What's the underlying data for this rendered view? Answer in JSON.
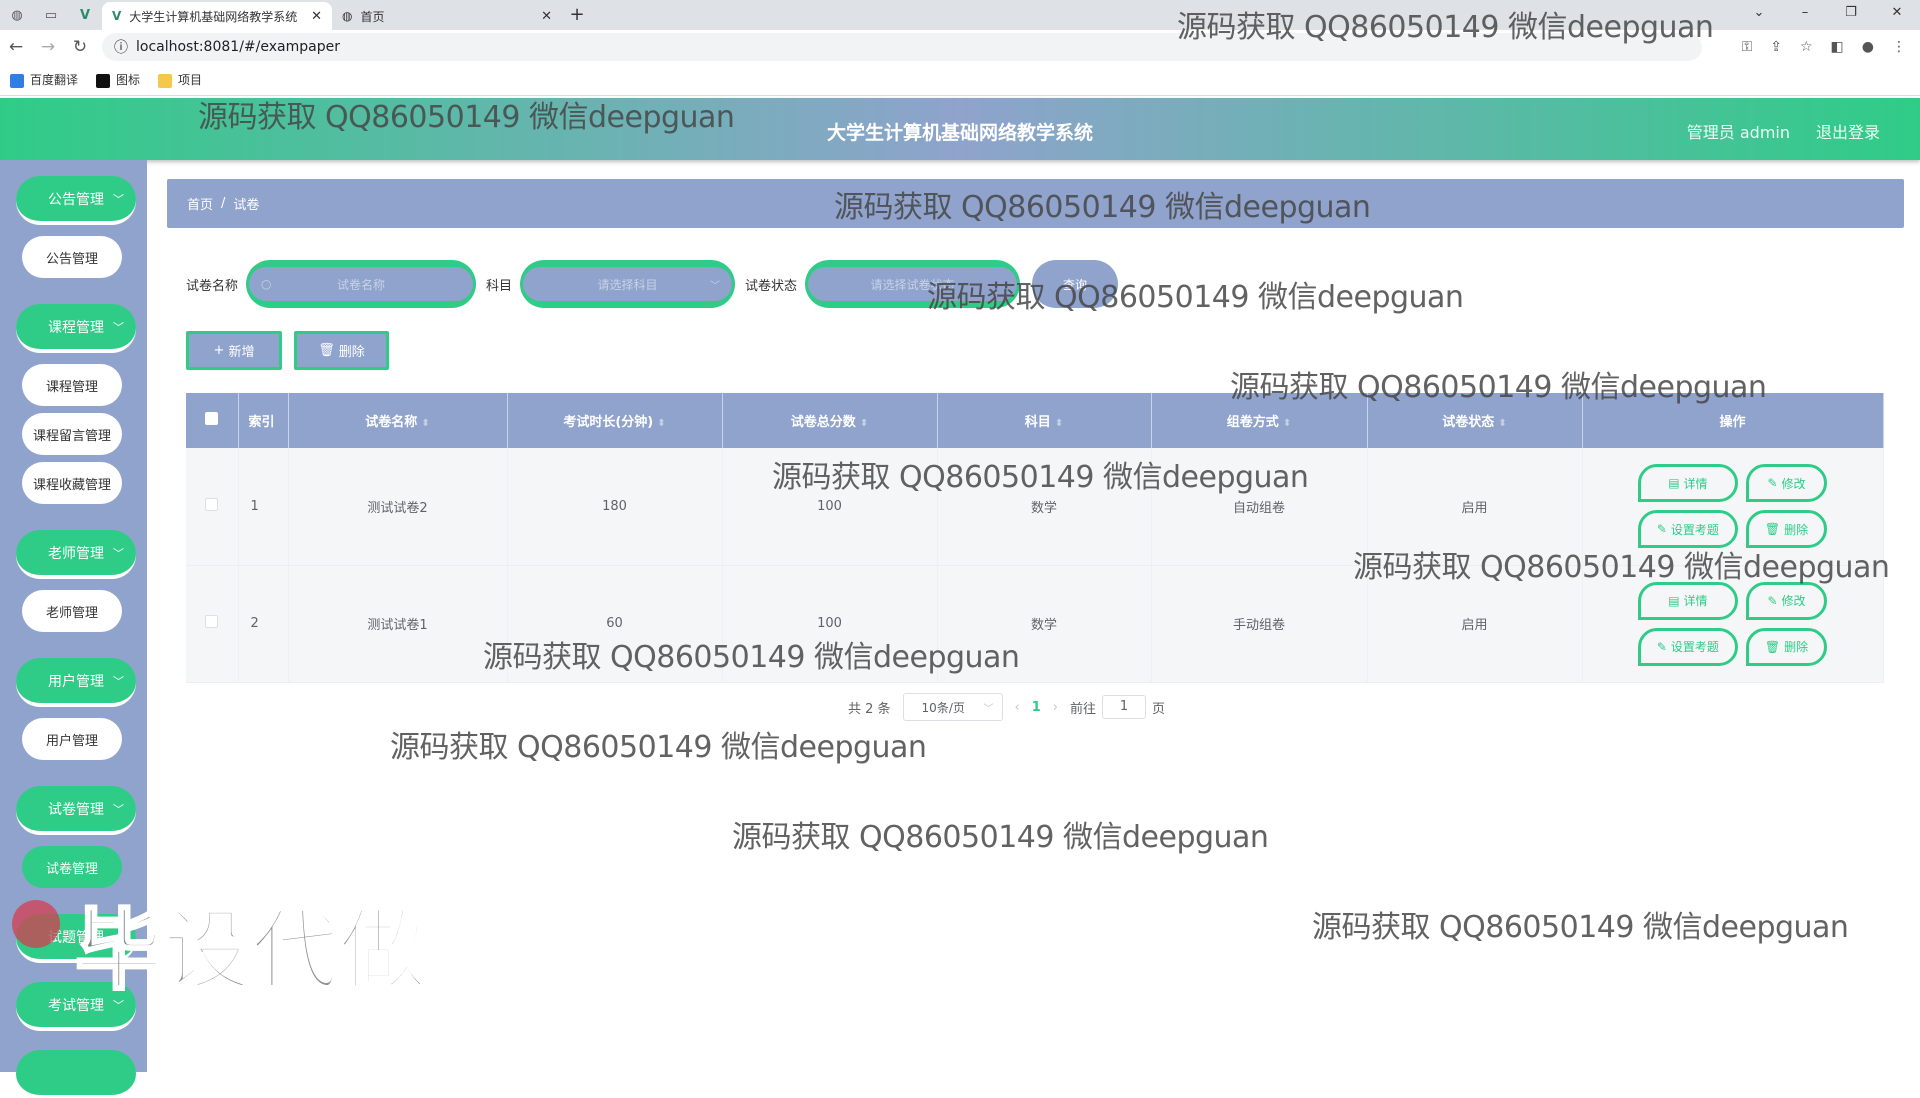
{
  "browser": {
    "tabs": [
      {
        "title": "大学生计算机基础网络教学系统",
        "active": true
      },
      {
        "title": "首页",
        "active": false
      }
    ],
    "url": "localhost:8081/#/exampaper",
    "bookmarks": [
      "百度翻译",
      "图标",
      "项目"
    ]
  },
  "header": {
    "title": "大学生计算机基础网络教学系统",
    "user": "管理员 admin",
    "logout": "退出登录"
  },
  "sidebar": {
    "menus": [
      {
        "label": "公告管理",
        "subs": [
          "公告管理"
        ]
      },
      {
        "label": "课程管理",
        "subs": [
          "课程管理",
          "课程留言管理",
          "课程收藏管理"
        ]
      },
      {
        "label": "老师管理",
        "subs": [
          "老师管理"
        ]
      },
      {
        "label": "用户管理",
        "subs": [
          "用户管理"
        ]
      },
      {
        "label": "试卷管理",
        "subs": [
          "试卷管理"
        ]
      },
      {
        "label": "试题管理",
        "subs": []
      },
      {
        "label": "考试管理",
        "subs": []
      }
    ],
    "active_sub": "试卷管理"
  },
  "breadcrumb": [
    "首页",
    "试卷"
  ],
  "search": {
    "name_label": "试卷名称",
    "name_placeholder": "试卷名称",
    "subject_label": "科目",
    "subject_placeholder": "请选择科目",
    "status_label": "试卷状态",
    "status_placeholder": "请选择试卷状态",
    "query": "查询"
  },
  "actions": {
    "add": "新增",
    "delete": "删除"
  },
  "table": {
    "columns": [
      "索引",
      "试卷名称",
      "考试时长(分钟)",
      "试卷总分数",
      "科目",
      "组卷方式",
      "试卷状态",
      "操作"
    ],
    "rows": [
      {
        "index": "1",
        "name": "测试试卷2",
        "duration": "180",
        "total": "100",
        "subject": "数学",
        "mode": "自动组卷",
        "status": "启用"
      },
      {
        "index": "2",
        "name": "测试试卷1",
        "duration": "60",
        "total": "100",
        "subject": "数学",
        "mode": "手动组卷",
        "status": "启用"
      }
    ],
    "ops": {
      "detail": "详情",
      "edit": "修改",
      "set": "设置考题",
      "del": "删除"
    }
  },
  "pager": {
    "total": "共 2 条",
    "size": "10条/页",
    "current": "1",
    "goto": "前往",
    "goto_value": "1",
    "page_unit": "页"
  },
  "watermark": {
    "text": "源码获取 QQ86050149 微信deepguan",
    "big": "毕设代做"
  },
  "colors": {
    "accent": "#2fcc87",
    "primary": "#8fa3cc"
  }
}
